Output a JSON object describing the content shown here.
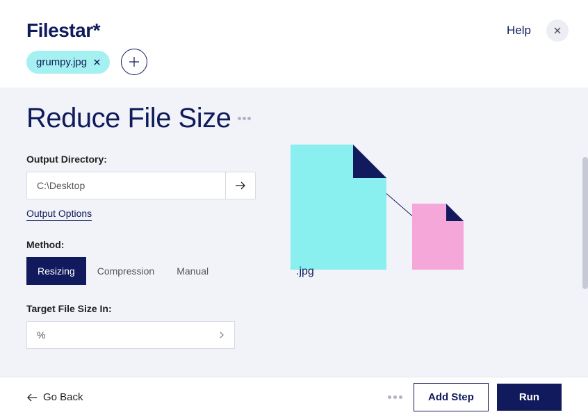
{
  "header": {
    "logo": "Filestar*",
    "help": "Help"
  },
  "files": {
    "chip": "grumpy.jpg"
  },
  "page": {
    "title": "Reduce File Size"
  },
  "output": {
    "label": "Output Directory:",
    "value": "C:\\Desktop",
    "options": "Output Options"
  },
  "method": {
    "label": "Method:",
    "tabs": {
      "resizing": "Resizing",
      "compression": "Compression",
      "manual": "Manual"
    }
  },
  "target": {
    "label": "Target File Size In:",
    "value": "%"
  },
  "illustration": {
    "ext": ".jpg"
  },
  "footer": {
    "back": "Go Back",
    "addStep": "Add Step",
    "run": "Run"
  }
}
